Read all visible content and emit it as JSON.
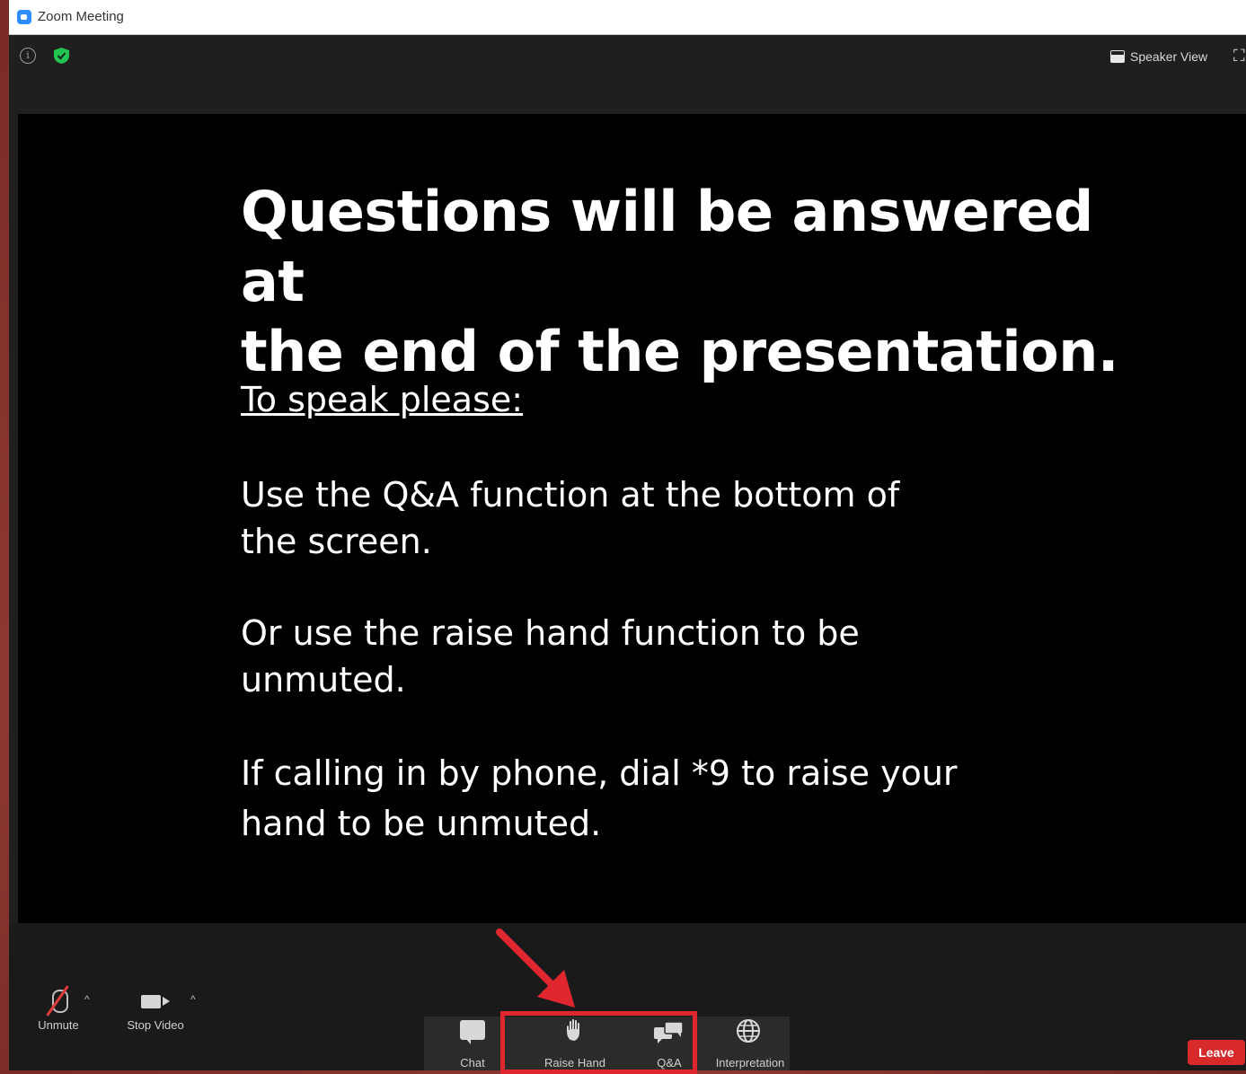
{
  "window": {
    "title": "Zoom Meeting"
  },
  "topbar": {
    "speaker_view_label": "Speaker View"
  },
  "slide": {
    "heading_line1": "Questions will be answered at",
    "heading_line2": "the end of the presentation.",
    "subheading": "To speak please:",
    "para1_line1": "Use the Q&A function at the bottom of",
    "para1_line2": "the screen.",
    "para2_line1": "Or use the raise hand function to be",
    "para2_line2": "unmuted.",
    "para3_line1": "If calling in by phone, dial *9 to raise your",
    "para3_line2": "hand to be unmuted."
  },
  "toolbar": {
    "unmute_label": "Unmute",
    "stop_video_label": "Stop Video",
    "chat_label": "Chat",
    "raise_hand_label": "Raise Hand",
    "qa_label": "Q&A",
    "interpretation_label": "Interpretation",
    "leave_label": "Leave"
  },
  "colors": {
    "highlight": "#e0262e",
    "leave": "#d82a2a",
    "shield": "#23c552"
  },
  "icons": [
    "info-icon",
    "shield-icon",
    "grid-icon",
    "fullscreen-icon",
    "mic-muted-icon",
    "camera-icon",
    "chat-icon",
    "hand-icon",
    "qa-icon",
    "globe-icon"
  ]
}
